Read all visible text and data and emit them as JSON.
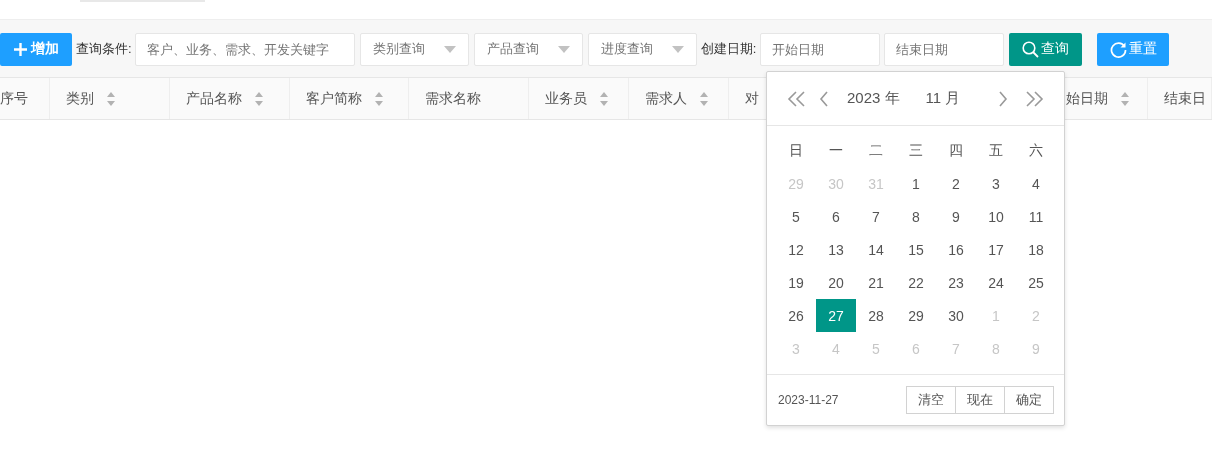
{
  "toolbar": {
    "add_button": "增加",
    "query_label": "查询条件:",
    "keyword": {
      "placeholder": "客户、业务、需求、开发关键字"
    },
    "selects": [
      {
        "placeholder": "类别查询"
      },
      {
        "placeholder": "产品查询"
      },
      {
        "placeholder": "进度查询"
      }
    ],
    "date_label": "创建日期:",
    "start_date": {
      "placeholder": "开始日期"
    },
    "end_date": {
      "placeholder": "结束日期"
    },
    "search_button": "查询",
    "reset_button": "重置"
  },
  "table": {
    "columns": [
      {
        "label": "序号",
        "sortable": false
      },
      {
        "label": "类别",
        "sortable": true
      },
      {
        "label": "产品名称",
        "sortable": true
      },
      {
        "label": "客户简称",
        "sortable": true
      },
      {
        "label": "需求名称",
        "sortable": false
      },
      {
        "label": "业务员",
        "sortable": true
      },
      {
        "label": "需求人",
        "sortable": true
      },
      {
        "label": "对",
        "sortable": false
      },
      {
        "label": "始日期",
        "sortable": true
      },
      {
        "label": "结束日",
        "sortable": false
      }
    ]
  },
  "date_picker": {
    "year": "2023 年",
    "month": "11 月",
    "weekdays": [
      "日",
      "一",
      "二",
      "三",
      "四",
      "五",
      "六"
    ],
    "days": [
      {
        "label": "29",
        "current_month": false,
        "selected": false
      },
      {
        "label": "30",
        "current_month": false,
        "selected": false
      },
      {
        "label": "31",
        "current_month": false,
        "selected": false
      },
      {
        "label": "1",
        "current_month": true,
        "selected": false
      },
      {
        "label": "2",
        "current_month": true,
        "selected": false
      },
      {
        "label": "3",
        "current_month": true,
        "selected": false
      },
      {
        "label": "4",
        "current_month": true,
        "selected": false
      },
      {
        "label": "5",
        "current_month": true,
        "selected": false
      },
      {
        "label": "6",
        "current_month": true,
        "selected": false
      },
      {
        "label": "7",
        "current_month": true,
        "selected": false
      },
      {
        "label": "8",
        "current_month": true,
        "selected": false
      },
      {
        "label": "9",
        "current_month": true,
        "selected": false
      },
      {
        "label": "10",
        "current_month": true,
        "selected": false
      },
      {
        "label": "11",
        "current_month": true,
        "selected": false
      },
      {
        "label": "12",
        "current_month": true,
        "selected": false
      },
      {
        "label": "13",
        "current_month": true,
        "selected": false
      },
      {
        "label": "14",
        "current_month": true,
        "selected": false
      },
      {
        "label": "15",
        "current_month": true,
        "selected": false
      },
      {
        "label": "16",
        "current_month": true,
        "selected": false
      },
      {
        "label": "17",
        "current_month": true,
        "selected": false
      },
      {
        "label": "18",
        "current_month": true,
        "selected": false
      },
      {
        "label": "19",
        "current_month": true,
        "selected": false
      },
      {
        "label": "20",
        "current_month": true,
        "selected": false
      },
      {
        "label": "21",
        "current_month": true,
        "selected": false
      },
      {
        "label": "22",
        "current_month": true,
        "selected": false
      },
      {
        "label": "23",
        "current_month": true,
        "selected": false
      },
      {
        "label": "24",
        "current_month": true,
        "selected": false
      },
      {
        "label": "25",
        "current_month": true,
        "selected": false
      },
      {
        "label": "26",
        "current_month": true,
        "selected": false
      },
      {
        "label": "27",
        "current_month": true,
        "selected": true
      },
      {
        "label": "28",
        "current_month": true,
        "selected": false
      },
      {
        "label": "29",
        "current_month": true,
        "selected": false
      },
      {
        "label": "30",
        "current_month": true,
        "selected": false
      },
      {
        "label": "1",
        "current_month": false,
        "selected": false
      },
      {
        "label": "2",
        "current_month": false,
        "selected": false
      },
      {
        "label": "3",
        "current_month": false,
        "selected": false
      },
      {
        "label": "4",
        "current_month": false,
        "selected": false
      },
      {
        "label": "5",
        "current_month": false,
        "selected": false
      },
      {
        "label": "6",
        "current_month": false,
        "selected": false
      },
      {
        "label": "7",
        "current_month": false,
        "selected": false
      },
      {
        "label": "8",
        "current_month": false,
        "selected": false
      },
      {
        "label": "9",
        "current_month": false,
        "selected": false
      }
    ],
    "selected_date": "2023-11-27",
    "buttons": [
      "清空",
      "现在",
      "确定"
    ]
  }
}
